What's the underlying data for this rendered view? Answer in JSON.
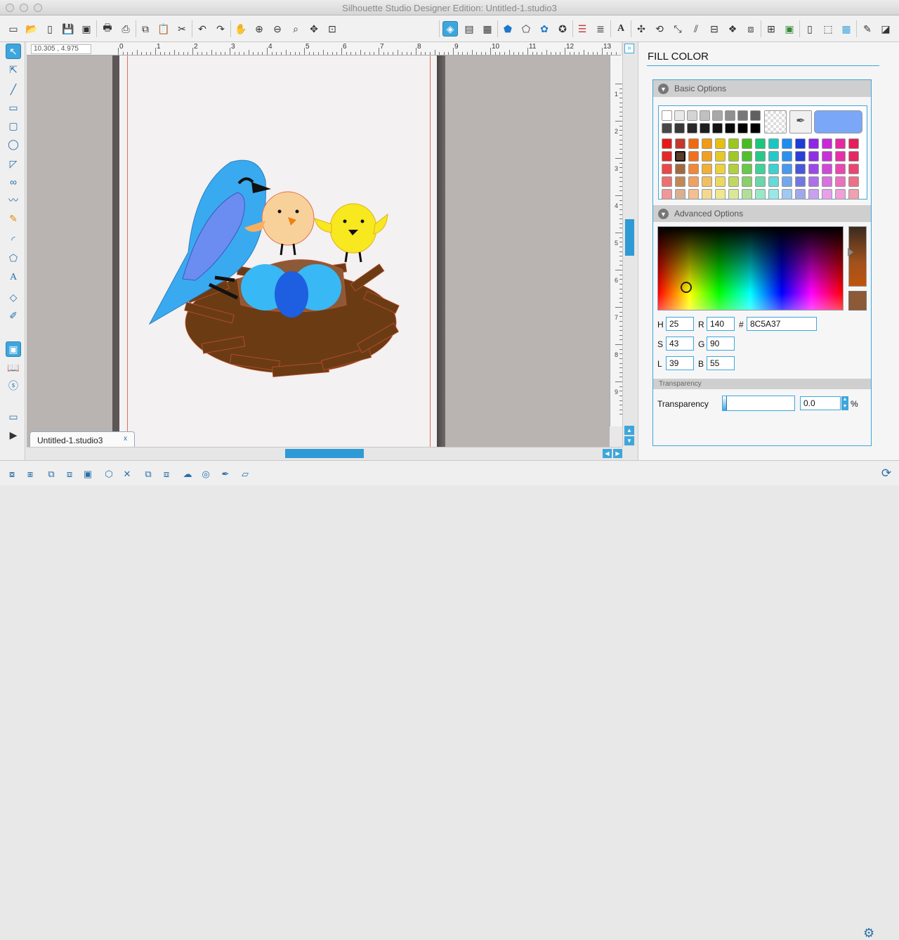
{
  "window": {
    "title": "Silhouette Studio Designer Edition: Untitled-1.studio3"
  },
  "toolbar": {
    "icons": [
      "new-icon",
      "open-icon",
      "library-icon",
      "save-icon",
      "save-library-icon",
      "print-icon",
      "send-cut-icon",
      "copy-icon",
      "paste-icon",
      "cut-icon",
      "undo-icon",
      "redo-icon",
      "pan-icon",
      "zoom-in-icon",
      "zoom-out-icon",
      "zoom-select-icon",
      "zoom-drag-icon",
      "fit-page-icon",
      "fill-color-icon",
      "gradient-icon",
      "pattern-icon",
      "line-color-icon",
      "line-style-icon",
      "line-width-icon",
      "text-style-icon",
      "text-icon",
      "transform-icon",
      "rotate-icon",
      "scale-icon",
      "shear-icon",
      "align-icon",
      "replicate-icon",
      "offset-icon",
      "trace-icon",
      "modify-icon",
      "cut-settings-icon",
      "page-setup-icon",
      "store-icon",
      "grid-icon",
      "sketch-icon",
      "eraser-icon"
    ]
  },
  "ruler": {
    "coord": "10.305 , 4.975",
    "labels": [
      "0",
      "1",
      "2",
      "3",
      "4",
      "5",
      "6",
      "7",
      "8",
      "9",
      "10",
      "11",
      "12",
      "13"
    ],
    "vlabels": [
      "1",
      "2",
      "3",
      "4",
      "5",
      "6",
      "7",
      "8",
      "9"
    ]
  },
  "document": {
    "tab_name": "Untitled-1.studio3",
    "tab_close": "x"
  },
  "panel": {
    "title": "FILL COLOR",
    "basic_options": "Basic Options",
    "advanced_options": "Advanced Options",
    "transparency_header": "Transparency",
    "transparency_label": "Transparency",
    "transparency_value": "0.0",
    "transparency_unit": "%",
    "hsl": {
      "h_label": "H",
      "h": "25",
      "s_label": "S",
      "s": "43",
      "l_label": "L",
      "l": "39"
    },
    "rgb": {
      "r_label": "R",
      "r": "140",
      "g_label": "G",
      "g": "90",
      "b_label": "B",
      "b": "55"
    },
    "hex_label": "#",
    "hex": "8C5A37",
    "selected_color": "#8c5a37",
    "current_fill": "#7aa7f7"
  },
  "palette": {
    "grays": [
      "#ffffff",
      "#e8e8e8",
      "#d4d4d4",
      "#c0c0c0",
      "#a8a8a8",
      "#909090",
      "#787878",
      "#606060",
      "#484848",
      "#383838",
      "#282828",
      "#1e1e1e",
      "#141414",
      "#0a0a0a",
      "#000000",
      "#000000"
    ],
    "rows": [
      [
        "#e41a1a",
        "#c0392b",
        "#f06a10",
        "#f29a10",
        "#e6c010",
        "#9ac81c",
        "#46bc20",
        "#18c878",
        "#18c8c0",
        "#1e8cf0",
        "#1e3cd8",
        "#8c28e6",
        "#c828d8",
        "#e628a0",
        "#e61e5a"
      ],
      [
        "#e42828",
        "#5a3c28",
        "#f07020",
        "#f0a020",
        "#e6c828",
        "#a0c828",
        "#50c030",
        "#28c888",
        "#28c8c8",
        "#2890f0",
        "#2840d8",
        "#9030e6",
        "#c830d8",
        "#e630a8",
        "#e62860"
      ],
      [
        "#e84848",
        "#a06a40",
        "#f08838",
        "#f0b038",
        "#ecd040",
        "#b0d040",
        "#68c848",
        "#40d098",
        "#40d0d0",
        "#4898f0",
        "#4858d8",
        "#9c48e6",
        "#d048d8",
        "#e848b0",
        "#e84870"
      ],
      [
        "#ec7070",
        "#c08858",
        "#f0a060",
        "#f0c060",
        "#ecd860",
        "#c0d860",
        "#88d068",
        "#68d8a8",
        "#68d8d8",
        "#70a8f0",
        "#7078e0",
        "#ac70ea",
        "#d870e0",
        "#ec70c0",
        "#ec7088"
      ],
      [
        "#f09898",
        "#d8b090",
        "#f4c090",
        "#f4d890",
        "#f0e890",
        "#d8e898",
        "#b0e098",
        "#98e8c8",
        "#98e8e8",
        "#a0c8f4",
        "#a0a8ec",
        "#c8a0f0",
        "#e8a0ec",
        "#f0a0d8",
        "#f0a0b0"
      ]
    ]
  }
}
